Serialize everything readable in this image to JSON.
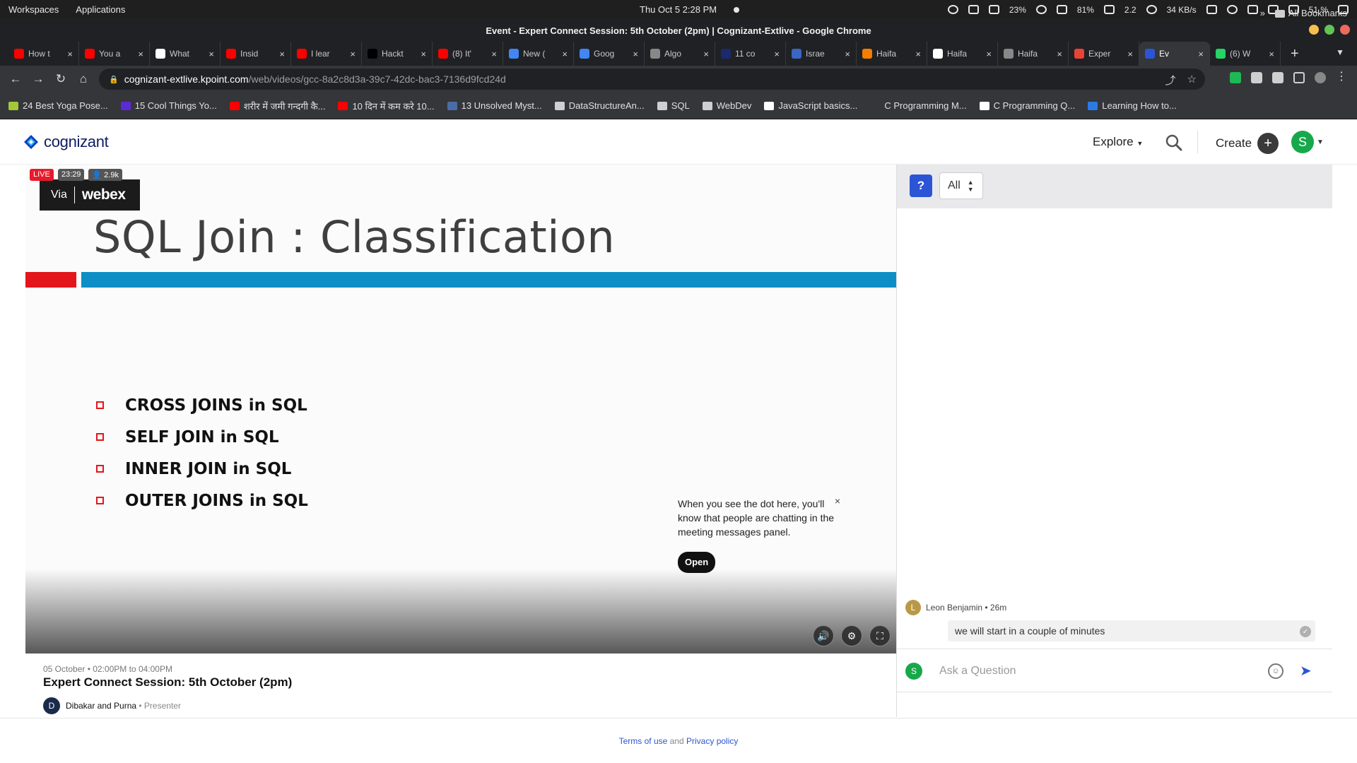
{
  "os": {
    "left_items": [
      "Workspaces",
      "Applications"
    ],
    "clock": "Thu Oct 5  2:28 PM",
    "stats": [
      "23%",
      "81%",
      "2.2",
      "34 KB/s",
      "51 %"
    ]
  },
  "window": {
    "title": "Event - Expert Connect Session: 5th October (2pm) | Cognizant-Extlive - Google Chrome"
  },
  "tabs": [
    {
      "label": "How t",
      "icon": "youtube-icon",
      "color": "#ff0000"
    },
    {
      "label": "You a",
      "icon": "youtube-icon",
      "color": "#ff0000"
    },
    {
      "label": "What",
      "icon": "hl-icon",
      "color": "#ffffff"
    },
    {
      "label": "Insid",
      "icon": "youtube-icon",
      "color": "#ff0000"
    },
    {
      "label": "I lear",
      "icon": "youtube-icon",
      "color": "#ff0000"
    },
    {
      "label": "Hackt",
      "icon": "dev-icon",
      "color": "#000000"
    },
    {
      "label": "(8) It'",
      "icon": "youtube-icon",
      "color": "#ff0000"
    },
    {
      "label": "New (",
      "icon": "google-cloud-icon",
      "color": "#4285f4"
    },
    {
      "label": "Goog",
      "icon": "google-cloud-icon",
      "color": "#4285f4"
    },
    {
      "label": "Algo",
      "icon": "globe-icon",
      "color": "#888888"
    },
    {
      "label": "11 co",
      "icon": "r-icon",
      "color": "#1a2a6c"
    },
    {
      "label": "Israe",
      "icon": "israel-icon",
      "color": "#3a66c4"
    },
    {
      "label": "Haifa",
      "icon": "blogger-icon",
      "color": "#f57d00"
    },
    {
      "label": "Haifa",
      "icon": "wikipedia-icon",
      "color": "#ffffff"
    },
    {
      "label": "Haifa",
      "icon": "globe-icon",
      "color": "#888888"
    },
    {
      "label": "Exper",
      "icon": "gmail-icon",
      "color": "#ea4335"
    },
    {
      "label": "Ev",
      "icon": "kpoint-icon",
      "color": "#2c55d6",
      "active": true
    },
    {
      "label": "(6) W",
      "icon": "whatsapp-icon",
      "color": "#25d366"
    }
  ],
  "address": {
    "host": "cognizant-extlive.kpoint.com",
    "path": "/web/videos/gcc-8a2c8d3a-39c7-42dc-bac3-7136d9fcd24d"
  },
  "bookmarks": [
    {
      "label": "24 Best Yoga Pose...",
      "color": "#a4c639"
    },
    {
      "label": "15 Cool Things Yo...",
      "color": "#5b2bd6"
    },
    {
      "label": "शरीर में जमी गन्दगी कै...",
      "color": "#ff0000"
    },
    {
      "label": "10 दिन में कम करे 10...",
      "color": "#ff0000"
    },
    {
      "label": "13 Unsolved Myst...",
      "color": "#4a6da7"
    },
    {
      "label": "DataStructureAn...",
      "color": "#cfcfcf"
    },
    {
      "label": "SQL",
      "color": "#cfcfcf"
    },
    {
      "label": "WebDev",
      "color": "#cfcfcf"
    },
    {
      "label": "JavaScript basics...",
      "color": "#ffffff"
    },
    {
      "label": "C Programming M...",
      "color": "#35363a"
    },
    {
      "label": "C Programming Q...",
      "color": "#ffffff"
    },
    {
      "label": "Learning How to...",
      "color": "#2c7be5"
    }
  ],
  "bookmarks_right": {
    "more": "»",
    "all": "All Bookmarks"
  },
  "site": {
    "brand": "cognizant",
    "explore_label": "Explore",
    "create_label": "Create",
    "user_initial": "S"
  },
  "video": {
    "live_label": "LIVE",
    "duration": "23:29",
    "viewers": "2.9k",
    "via_label": "Via",
    "webex_label": "webex",
    "slide_title": "SQL Join : Classification",
    "bullets": [
      "CROSS JOINS in SQL",
      "SELF JOIN in SQL",
      "INNER JOIN in SQL",
      "OUTER JOINS in SQL"
    ],
    "tooltip_text": "When you see the dot here, you'll know that people are chatting in the meeting messages panel.",
    "tooltip_button": "Open"
  },
  "event": {
    "date": "05 October • 02:00PM to 04:00PM",
    "title": "Expert Connect Session: 5th October (2pm)",
    "presenter_initial": "D",
    "presenter": "Dibakar and Purna",
    "presenter_role": " • Presenter"
  },
  "panel": {
    "filter_value": "All",
    "message": {
      "author_initial": "L",
      "author": "Leon Benjamin",
      "time": " • 26m",
      "text": "we will start in a couple of minutes"
    },
    "ask_initial": "S",
    "ask_placeholder": "Ask a Question"
  },
  "footer": {
    "terms": "Terms of use",
    "and": " and ",
    "privacy": "Privacy policy"
  },
  "colors": {
    "accent": "#2c55d6",
    "live": "#e8192c",
    "slide_red": "#e3161b",
    "slide_blue": "#0d8fc6",
    "avatar_green": "#17a84b"
  }
}
